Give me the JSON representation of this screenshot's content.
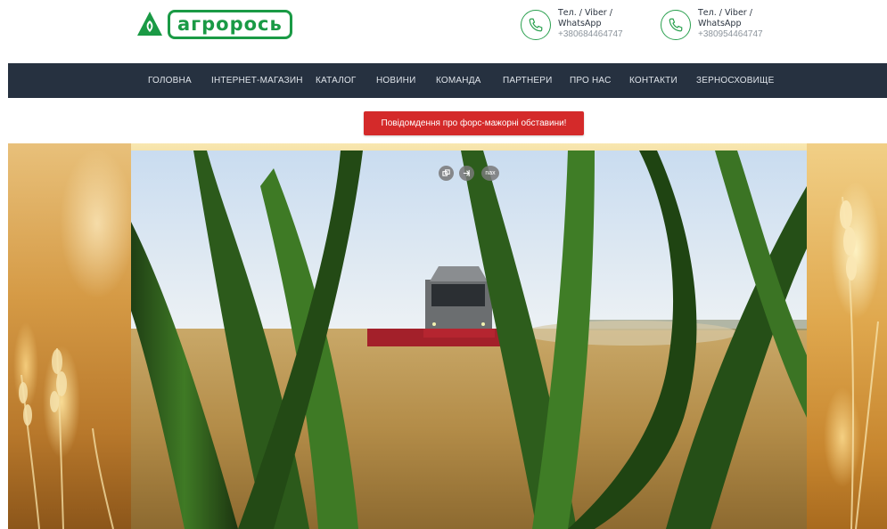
{
  "brand": {
    "logo_text": "агрорось",
    "logo_color": "#1a9a45"
  },
  "contacts": [
    {
      "label": "Тел. / Viber / WhatsApp",
      "number": "+380684464747",
      "icon": "phone-icon"
    },
    {
      "label": "Тел. / Viber / WhatsApp",
      "number": "+380954464747",
      "icon": "phone-icon"
    }
  ],
  "nav": {
    "background": "#263140",
    "items": [
      {
        "label": "ГОЛОВНА"
      },
      {
        "label": "ІНТЕРНЕТ-МАГАЗИН"
      },
      {
        "label": "КАТАЛОГ"
      },
      {
        "label": "НОВИНИ"
      },
      {
        "label": "КОМАНДА"
      },
      {
        "label": "ПАРТНЕРИ"
      },
      {
        "label": "ПРО НАС"
      },
      {
        "label": "КОНТАКТИ"
      },
      {
        "label": "ЗЕРНОСХОВИЩЕ"
      }
    ]
  },
  "notice": {
    "label": "Повідомдення про форс-мажорні обставини!",
    "color": "#d42a2a"
  },
  "video": {
    "controls": [
      {
        "icon": "copy-link-icon"
      },
      {
        "icon": "share-icon"
      },
      {
        "label": "nax"
      }
    ]
  }
}
